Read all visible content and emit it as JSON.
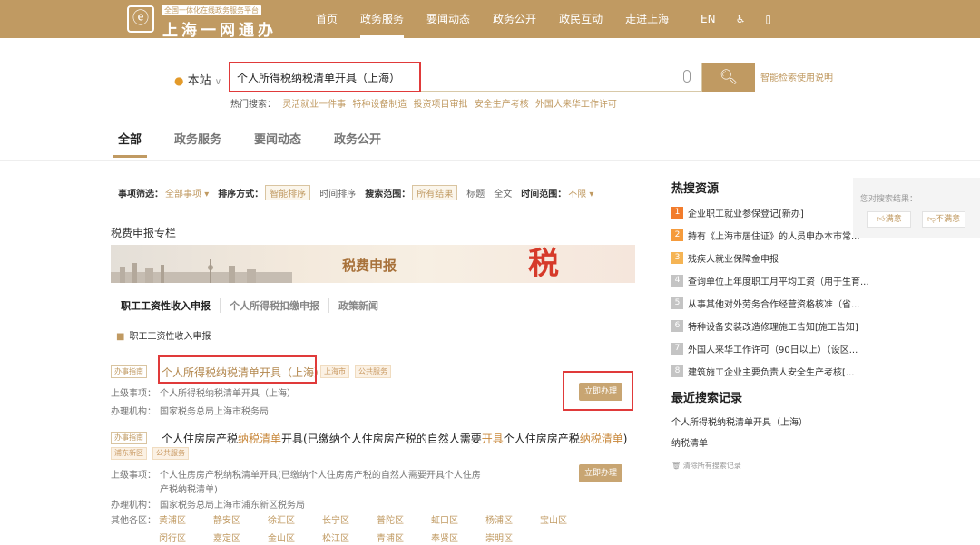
{
  "header": {
    "logo_tag": "全国一体化在线政务服务平台",
    "logo_title": "上海一网通办",
    "logo_icon": "seal-icon",
    "nav": [
      {
        "label": "首页",
        "active": false
      },
      {
        "label": "政务服务",
        "active": true
      },
      {
        "label": "要闻动态",
        "active": false
      },
      {
        "label": "政务公开",
        "active": false
      },
      {
        "label": "政民互动",
        "active": false
      },
      {
        "label": "走进上海",
        "active": false
      }
    ],
    "lang": "EN",
    "accessibility_icon": "accessibility-icon",
    "mobile_icon": "mobile-phone-icon"
  },
  "search": {
    "scope": "本站",
    "query": "个人所得税纳税清单开具（上海）",
    "help": "智能检索使用说明",
    "hot_label": "热门搜索：",
    "hot_keywords": [
      "灵活就业一件事",
      "特种设备制造",
      "投资项目审批",
      "安全生产考核",
      "外国人来华工作许可"
    ]
  },
  "categories": [
    "全部",
    "政务服务",
    "要闻动态",
    "政务公开"
  ],
  "filters": {
    "item_label": "事项筛选：",
    "item_value": "全部事项",
    "sort_label": "排序方式：",
    "sort_active": "智能排序",
    "sort_other": "时间排序",
    "range_label": "搜索范围：",
    "range_active": "所有结果",
    "range_title": "标题",
    "range_full": "全文",
    "time_label": "时间范围：",
    "time_value": "不限"
  },
  "column": {
    "title": "税费申报专栏",
    "banner_text": "税费申报",
    "banner_glyph": "税",
    "tabs": [
      "职工工资性收入申报",
      "个人所得税扣缴申报",
      "政策新闻"
    ],
    "link": "职工工资性收入申报"
  },
  "results": [
    {
      "type_tag": "办事指南",
      "title": "个人所得税纳税清单开具（上海）",
      "tags": [
        "上海市",
        "公共服务"
      ],
      "parent_label": "上级事项：",
      "parent": "个人所得税纳税清单开具（上海）",
      "org_label": "办理机构：",
      "org": "国家税务总局上海市税务局",
      "button": "立即办理"
    },
    {
      "type_tag": "办事指南",
      "title_p1": "个人住房房产税",
      "title_h1": "纳税清单",
      "title_p2": "开具(已缴纳个人住房房产税的自然人需要",
      "title_h2": "开具",
      "title_p3": "个人住房房产税",
      "title_h3": "纳税清单",
      "title_p4": ")",
      "tags": [
        "浦东新区",
        "公共服务"
      ],
      "parent_label": "上级事项：",
      "parent_line1": "个人住房房产税纳税清单开具(已缴纳个人住房房产税的自然人需要开具个人住房",
      "parent_line2": "产税纳税清单)",
      "org_label": "办理机构：",
      "org": "国家税务总局上海市浦东新区税务局",
      "districts_label": "其他各区：",
      "districts": [
        "黄浦区",
        "静安区",
        "徐汇区",
        "长宁区",
        "普陀区",
        "虹口区",
        "杨浦区",
        "宝山区",
        "闵行区",
        "嘉定区",
        "金山区",
        "松江区",
        "青浦区",
        "奉贤区",
        "崇明区"
      ],
      "button": "立即办理"
    }
  ],
  "sidebar": {
    "hot_title": "热搜资源",
    "hot_items": [
      "企业职工就业参保登记[新办]",
      "持有《上海市居住证》的人员申办本市常...",
      "残疾人就业保障金申报",
      "查询单位上年度职工月平均工资（用于生育...",
      "从事其他对外劳务合作经营资格核准（省...",
      "特种设备安装改造修理施工告知[施工告知]",
      "外国人来华工作许可（90日以上）（设区...",
      "建筑施工企业主要负责人安全生产考核[..."
    ],
    "recent_title": "最近搜索记录",
    "recent_items": [
      "个人所得税纳税清单开具（上海）",
      "纳税清单"
    ],
    "clear": "清除所有搜索记录"
  },
  "feedback": {
    "title": "您对搜索结果：",
    "good": "满意",
    "bad": "不满意"
  },
  "colors": {
    "brand": "#c09a62",
    "highlight_frame": "#e03a3a"
  }
}
